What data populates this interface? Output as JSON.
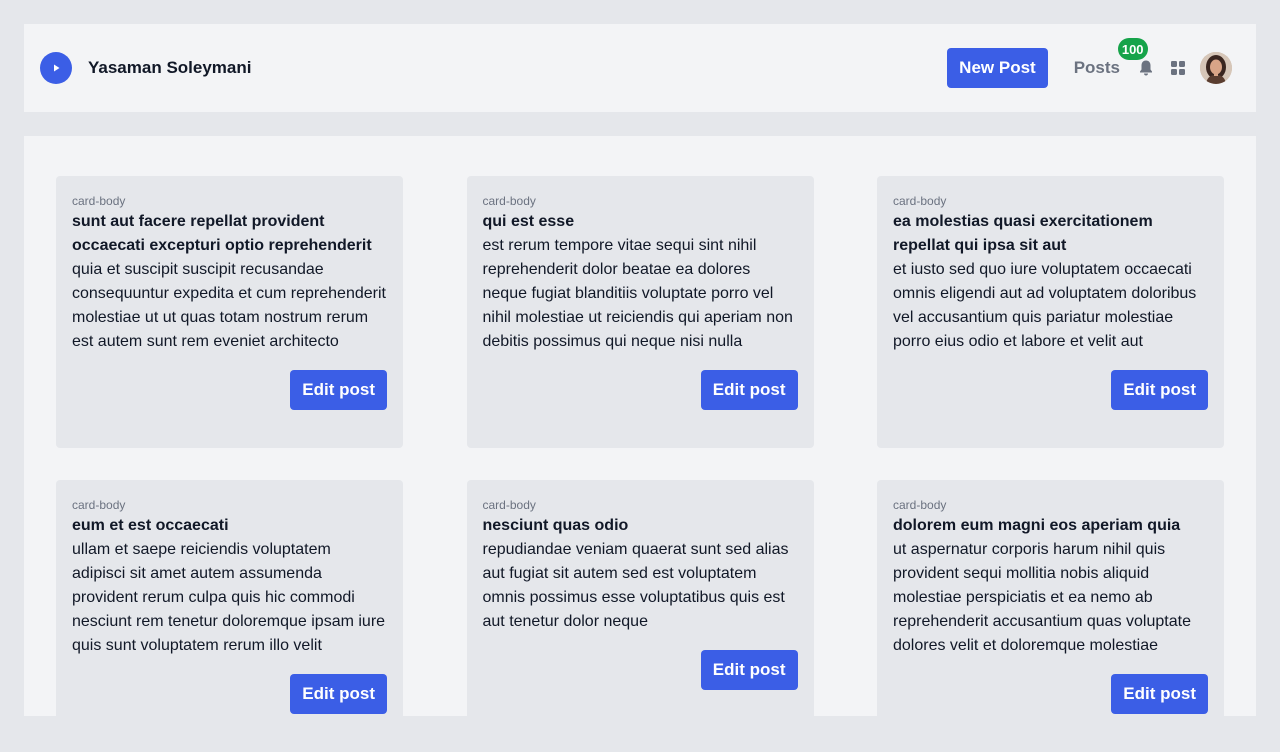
{
  "header": {
    "brand_name": "Yasaman Soleymani",
    "new_post_label": "New Post",
    "posts_label": "Posts",
    "posts_count": "100",
    "icons": [
      "play-icon",
      "bell-icon",
      "grid-icon",
      "avatar"
    ]
  },
  "colors": {
    "accent": "#3b5ee6",
    "badge": "#16a34a",
    "page_bg": "#e5e7eb",
    "panel_bg": "#f3f4f6"
  },
  "cards": [
    {
      "label": "card-body",
      "title": "sunt aut facere repellat provident occaecati excepturi optio reprehenderit",
      "body": "quia et suscipit suscipit recusandae consequuntur expedita et cum reprehenderit molestiae ut ut quas totam nostrum rerum est autem sunt rem eveniet architecto",
      "button": "Edit post"
    },
    {
      "label": "card-body",
      "title": "qui est esse",
      "body": "est rerum tempore vitae sequi sint nihil reprehenderit dolor beatae ea dolores neque fugiat blanditiis voluptate porro vel nihil molestiae ut reiciendis qui aperiam non debitis possimus qui neque nisi nulla",
      "button": "Edit post"
    },
    {
      "label": "card-body",
      "title": "ea molestias quasi exercitationem repellat qui ipsa sit aut",
      "body": "et iusto sed quo iure voluptatem occaecati omnis eligendi aut ad voluptatem doloribus vel accusantium quis pariatur molestiae porro eius odio et labore et velit aut",
      "button": "Edit post"
    },
    {
      "label": "card-body",
      "title": "eum et est occaecati",
      "body": "ullam et saepe reiciendis voluptatem adipisci sit amet autem assumenda provident rerum culpa quis hic commodi nesciunt rem tenetur doloremque ipsam iure quis sunt voluptatem rerum illo velit",
      "button": "Edit post"
    },
    {
      "label": "card-body",
      "title": "nesciunt quas odio",
      "body": "repudiandae veniam quaerat sunt sed alias aut fugiat sit autem sed est voluptatem omnis possimus esse voluptatibus quis est aut tenetur dolor neque",
      "button": "Edit post"
    },
    {
      "label": "card-body",
      "title": "dolorem eum magni eos aperiam quia",
      "body": "ut aspernatur corporis harum nihil quis provident sequi mollitia nobis aliquid molestiae perspiciatis et ea nemo ab reprehenderit accusantium quas voluptate dolores velit et doloremque molestiae",
      "button": "Edit post"
    }
  ]
}
